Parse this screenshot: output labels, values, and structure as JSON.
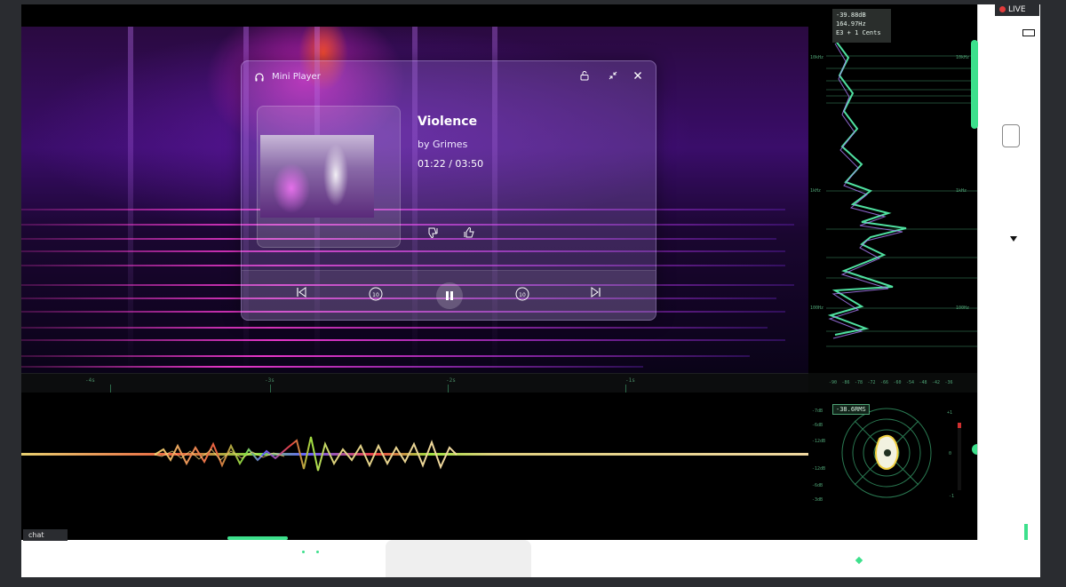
{
  "mini_player": {
    "title": "Mini Player",
    "track_title": "Violence",
    "artist": "by Grimes",
    "elapsed": "01:22",
    "separator": "/",
    "duration": "03:50",
    "skip_back_seconds": "10",
    "skip_forward_seconds": "10"
  },
  "analyzer": {
    "readout_db": "-39.88dB",
    "readout_hz": "164.97Hz",
    "readout_note": "E3  + 1 Cents",
    "freq_labels_left": [
      "10kHz",
      "1kHz",
      "100Hz"
    ],
    "freq_labels_right": [
      "10kHz",
      "1kHz",
      "100Hz"
    ],
    "db_ticks": [
      "-90",
      "-86",
      "-78",
      "-72",
      "-66",
      "-60",
      "-54",
      "-48",
      "-42",
      "-36"
    ]
  },
  "timeline": {
    "ticks": [
      "-4s",
      "-3s",
      "-2s",
      "-1s"
    ]
  },
  "meter": {
    "rms": "-38.6RMS",
    "db_labels": [
      "-7dB",
      "-6dB",
      "-12dB",
      "-12dB",
      "-6dB",
      "-3dB"
    ],
    "scale": [
      "+1",
      "0",
      "-1"
    ]
  },
  "overlay": {
    "live_label": "LIVE",
    "chat_label": "chat"
  }
}
